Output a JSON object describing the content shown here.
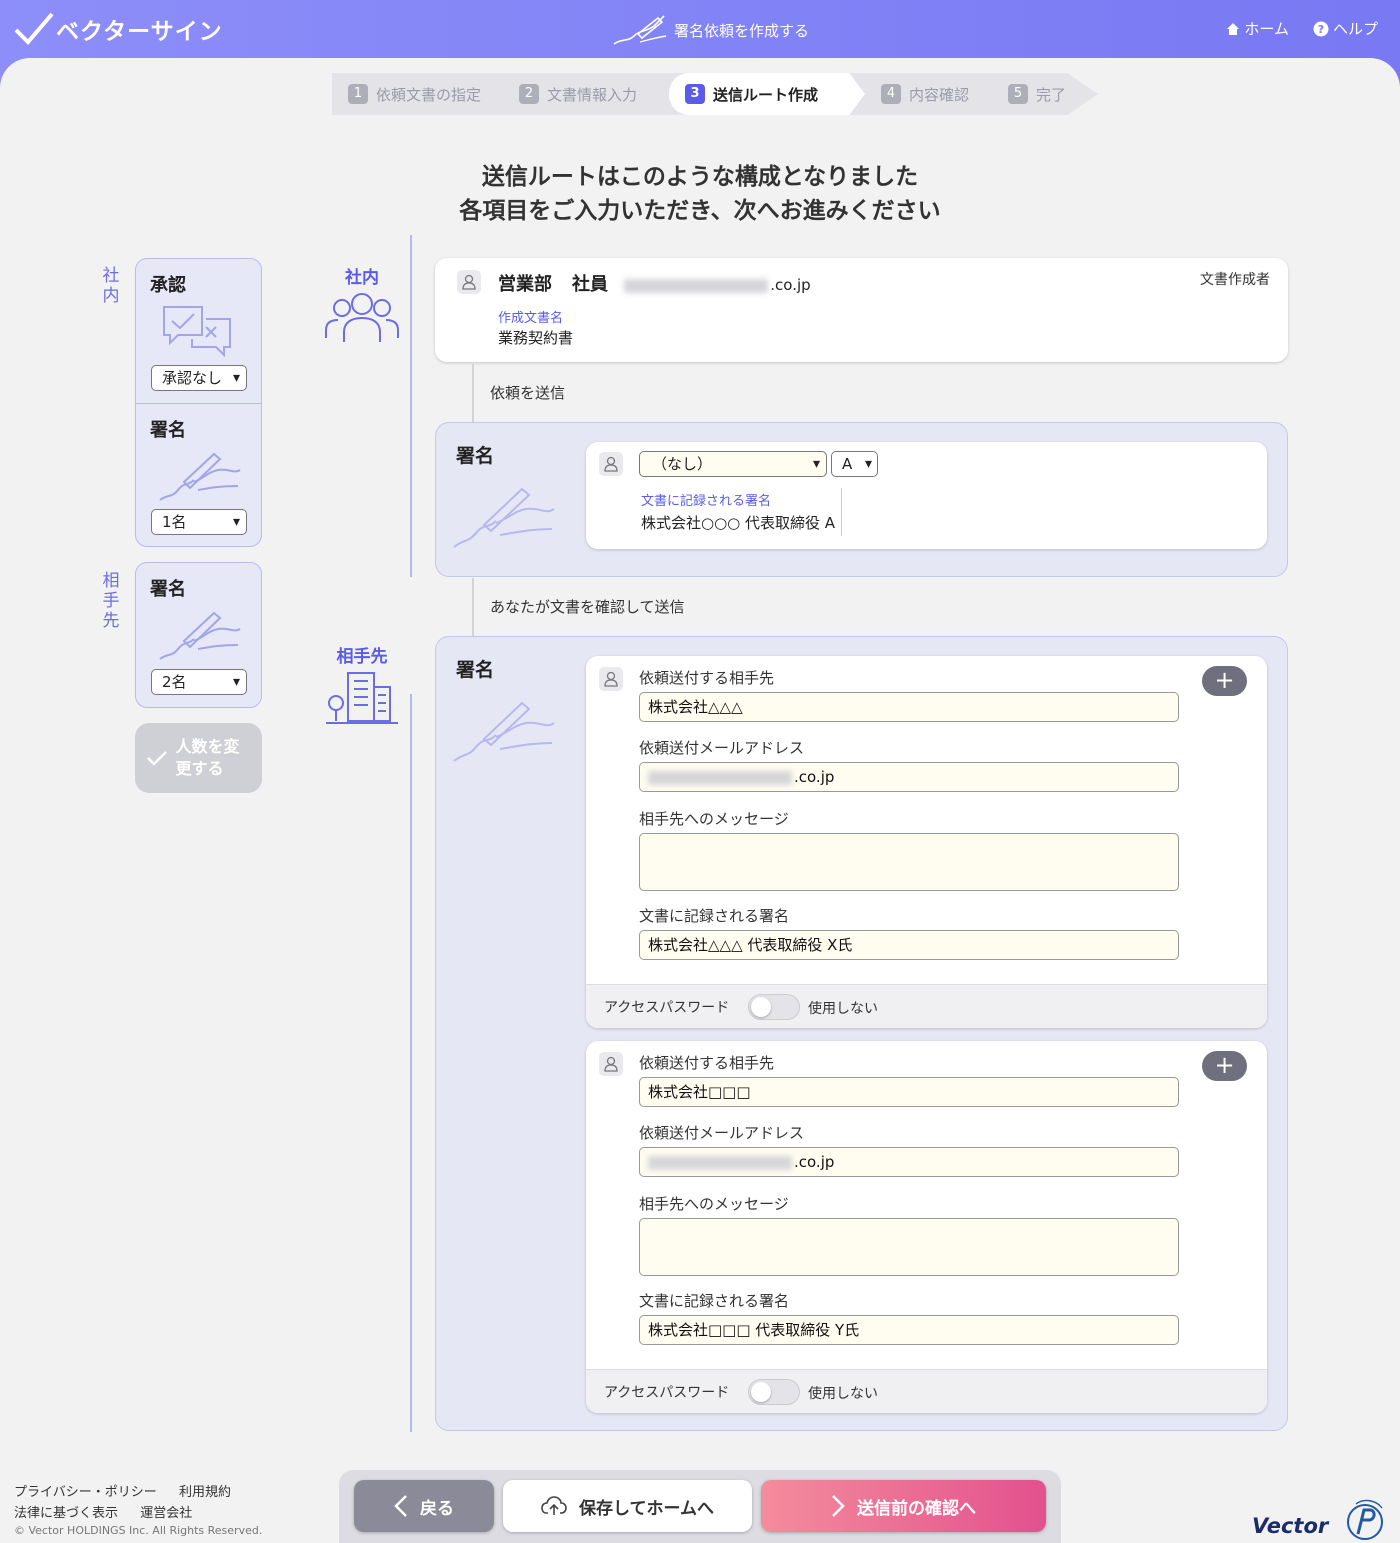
{
  "header": {
    "app_name": "ベクターサイン",
    "title": "署名依頼を作成する",
    "nav": [
      {
        "label": "ホーム"
      },
      {
        "label": "ヘルプ"
      }
    ]
  },
  "steps": [
    {
      "num": "1",
      "label": "依頼文書の指定"
    },
    {
      "num": "2",
      "label": "文書情報入力"
    },
    {
      "num": "3",
      "label": "送信ルート作成"
    },
    {
      "num": "4",
      "label": "内容確認"
    },
    {
      "num": "5",
      "label": "完了"
    }
  ],
  "heading": {
    "line1": "送信ルートはこのような構成となりました",
    "line2": "各項目をご入力いただき、次へお進みください"
  },
  "sidebar": {
    "internal_label": "社内",
    "approval": {
      "title": "承認",
      "value": "承認なし"
    },
    "internal_sign": {
      "title": "署名",
      "value": "1名"
    },
    "external_label": "相手先",
    "external_sign": {
      "title": "署名",
      "value": "2名"
    },
    "change_button": "人数を変更する"
  },
  "groups": {
    "internal": "社内",
    "external": "相手先"
  },
  "creator": {
    "dept": "営業部",
    "role": "社員",
    "email_suffix": ".co.jp",
    "badge": "文書作成者",
    "doc_name_label": "作成文書名",
    "doc_name": "業務契約書"
  },
  "conn1": "依頼を送信",
  "conn2": "あなたが文書を確認して送信",
  "internal_sign_block": {
    "title": "署名",
    "person_select": "（なし）",
    "letter_select": "A",
    "record_label": "文書に記録される署名",
    "record_value": "株式会社○○○ 代表取締役 A"
  },
  "external_block": {
    "title": "署名",
    "recipients": [
      {
        "recipient_label": "依頼送付する相手先",
        "recipient_value": "株式会社△△△",
        "email_label": "依頼送付メールアドレス",
        "email_suffix": ".co.jp",
        "message_label": "相手先へのメッセージ",
        "message_value": "",
        "signature_label": "文書に記録される署名",
        "signature_value": "株式会社△△△ 代表取締役 X氏",
        "password_label": "アクセスパスワード",
        "password_state": "使用しない"
      },
      {
        "recipient_label": "依頼送付する相手先",
        "recipient_value": "株式会社□□□",
        "email_label": "依頼送付メールアドレス",
        "email_suffix": ".co.jp",
        "message_label": "相手先へのメッセージ",
        "message_value": "",
        "signature_label": "文書に記録される署名",
        "signature_value": "株式会社□□□ 代表取締役 Y氏",
        "password_label": "アクセスパスワード",
        "password_state": "使用しない"
      }
    ]
  },
  "footer": {
    "privacy": "プライバシー・ポリシー",
    "terms": "利用規約",
    "legal": "法律に基づく表示",
    "company": "運営会社",
    "copyright": "© Vector HOLDINGS Inc. All Rights Reserved.",
    "brand": "Vector"
  },
  "buttons": {
    "back": "戻る",
    "save": "保存してホームへ",
    "next": "送信前の確認へ"
  }
}
